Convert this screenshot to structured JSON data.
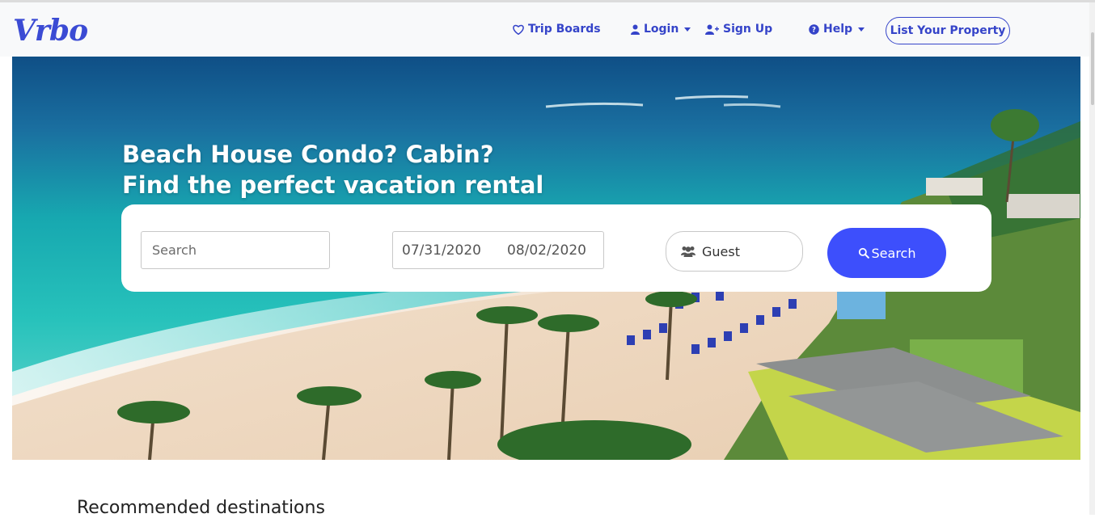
{
  "brand": {
    "logo_text": "Vrbo",
    "color": "#3b4bd4"
  },
  "nav": {
    "trip_boards": "Trip Boards",
    "login": "Login",
    "sign_up": "Sign Up",
    "help": "Help",
    "list_property": "List Your Property",
    "icons": {
      "trip_boards": "heart-icon",
      "login": "user-icon",
      "sign_up": "user-plus-icon",
      "help": "question-circle-icon"
    }
  },
  "hero": {
    "title_line1": "Beach House Condo? Cabin?",
    "title_line2": "Find the perfect vacation rental",
    "image": "aerial beach resort photo"
  },
  "search": {
    "placeholder": "Search",
    "check_in": "07/31/2020",
    "check_out": "08/02/2020",
    "guest_label": "Guest",
    "button_label": "Search",
    "button_color": "#3d4ffc"
  },
  "sections": {
    "recommended_title": "Recommended destinations"
  }
}
